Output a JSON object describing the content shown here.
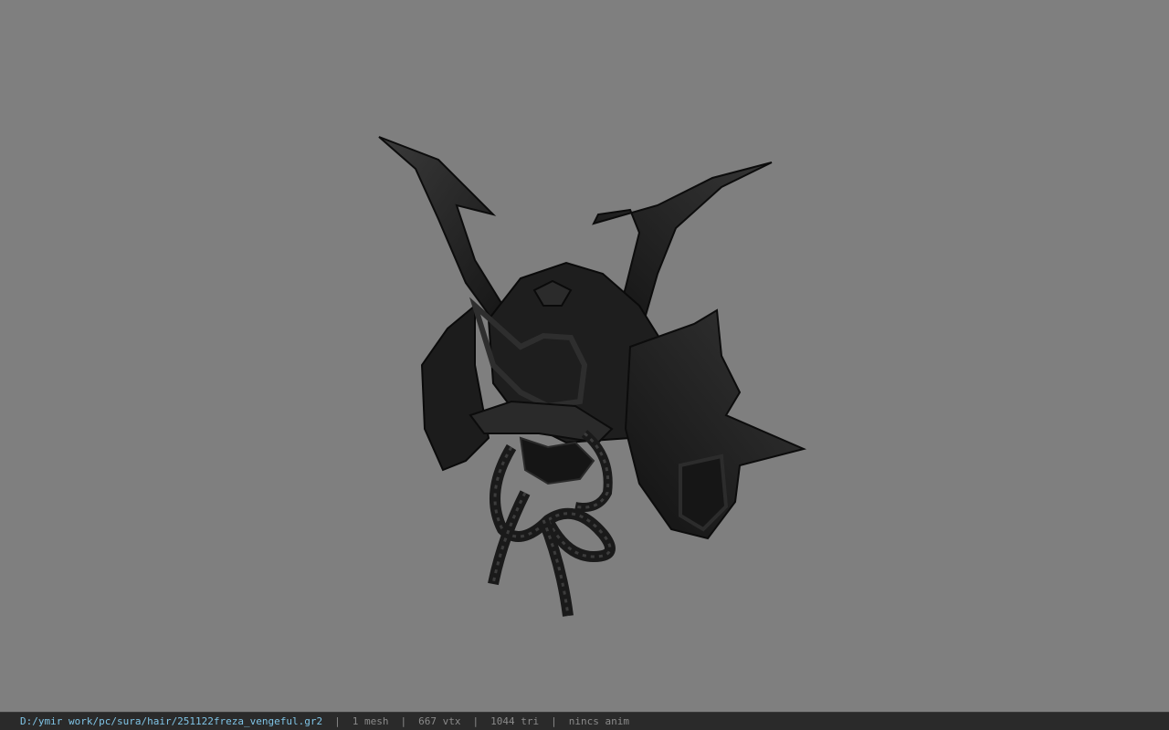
{
  "viewport": {
    "background_color": "#7f7f7f",
    "model_icon": "kabuto-helmet-model"
  },
  "statusbar": {
    "file_path": "D:/ymir work/pc/sura/hair/251122freza_vengeful.gr2",
    "mesh_count": "1 mesh",
    "vertex_count": "667 vtx",
    "triangle_count": "1044 tri",
    "animation": "nincs anim",
    "separator": "|",
    "path_color": "#7fc4e6",
    "text_color": "#8a8a8a"
  }
}
